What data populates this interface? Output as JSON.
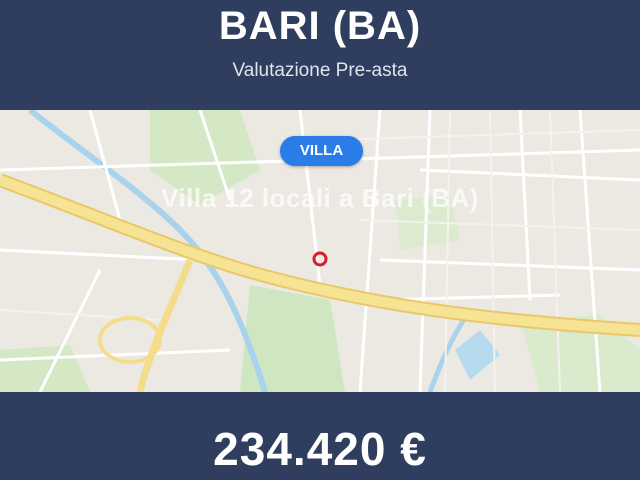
{
  "header": {
    "city_title": "BARI (BA)",
    "subtitle": "Valutazione Pre-asta"
  },
  "map": {
    "badge_label": "VILLA",
    "address_overlay": "Villa 12 locali a Bari (BA)",
    "marker_icon": "location-marker-icon",
    "colors": {
      "background": "#ece9e2",
      "park": "#cfe6c2",
      "water": "#a9d3ec",
      "highway": "#f5de82",
      "road": "#ffffff",
      "marker": "#d61f2e"
    }
  },
  "footer": {
    "price": "234.420 €"
  },
  "theme": {
    "panel_color": "#2f3e5e",
    "badge_color": "#2a7de9"
  }
}
